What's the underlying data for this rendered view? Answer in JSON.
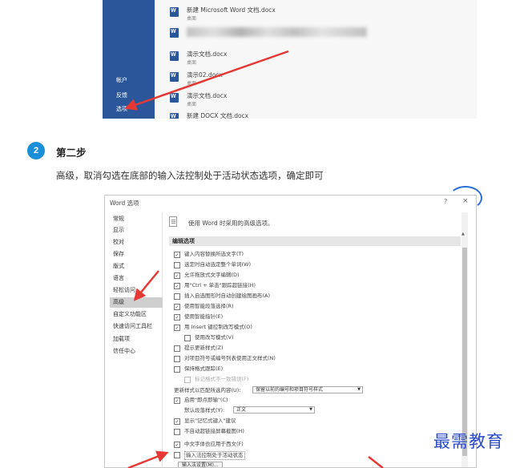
{
  "top_screenshot": {
    "sidebar": [
      {
        "label": "帐户"
      },
      {
        "label": "反馈"
      },
      {
        "label": "选项"
      }
    ],
    "recent_files": [
      {
        "name": "新建 Microsoft Word 文档.docx",
        "location": "桌面",
        "blurred": false
      },
      {
        "name": "",
        "location": "",
        "blurred": true
      },
      {
        "name": "演示文档.docx",
        "location": "桌面",
        "blurred": false
      },
      {
        "name": "演示02.docx",
        "location": "桌面",
        "blurred": false
      },
      {
        "name": "演示文档.docx",
        "location": "桌面",
        "blurred": false
      },
      {
        "name": "新建 DOCX 文档.docx",
        "location": "",
        "blurred": false
      }
    ]
  },
  "step": {
    "number": "2",
    "title": "第二步",
    "description": "高级，取消勾选在底部的输入法控制处于活动状态选项，确定即可"
  },
  "dialog": {
    "title": "Word 选项",
    "help": "?",
    "close": "×",
    "nav": [
      {
        "label": "常规"
      },
      {
        "label": "显示"
      },
      {
        "label": "校对"
      },
      {
        "label": "保存"
      },
      {
        "label": "版式"
      },
      {
        "label": "语言"
      },
      {
        "label": "轻松访问"
      },
      {
        "label": "高级",
        "selected": true
      },
      {
        "label": "自定义功能区"
      },
      {
        "label": "快速访问工具栏"
      },
      {
        "label": "加载项"
      },
      {
        "label": "信任中心"
      }
    ],
    "header": "使用 Word 时采用的高级选项。",
    "section": "编辑选项",
    "options": {
      "o1": "键入内容替换所选文字(T)",
      "o2": "选定时自动选定整个单词(W)",
      "o3": "允许拖放式文字编辑(D)",
      "o4": "用\"Ctrl + 单击\"跟踪超链接(H)",
      "o5": "插入自选图形时自动创建绘图画布(A)",
      "o6": "使用智能段落选择(R)",
      "o7": "使用智能指针(E)",
      "o8": "用 Insert 键控制改写模式(O)",
      "o9": "使用改写模式(V)",
      "o10": "提示更新样式(Z)",
      "o11": "对项目符号或编号列表使用正文样式(N)",
      "o12": "保持格式跟踪(E)",
      "o13": "标记格式不一致错误(F)",
      "style_update_label": "更新样式以匹配所选内容(U):",
      "style_update_value": "保留以前的编号和项目符号样式",
      "o14": "启用\"即点即输\"(C)",
      "default_para_label": "默认段落样式(Y):",
      "default_para_value": "正文",
      "o15": "显示\"记忆式键入\"建议",
      "o16": "不自动超链接屏幕截图(H)",
      "o17": "中文字体也应用于西文(F)",
      "o18": "输入法控制处于活动状态",
      "ime_settings": "输入法设置(M)..."
    },
    "checked": {
      "o1": true,
      "o2": false,
      "o3": true,
      "o4": true,
      "o5": false,
      "o6": true,
      "o7": true,
      "o8": true,
      "o9": false,
      "o10": false,
      "o11": false,
      "o12": false,
      "o13": false,
      "o14": true,
      "o15": true,
      "o16": false,
      "o17": true,
      "o18": false
    }
  },
  "watermark": "最需教育",
  "colors": {
    "word_blue": "#2b579a",
    "step_badge": "#1a8fd8",
    "arrow_red": "#e53935",
    "watermark": "#2a4cc8"
  }
}
